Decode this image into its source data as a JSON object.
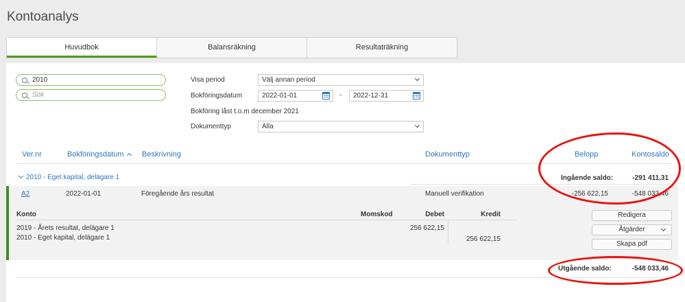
{
  "page": {
    "title": "Kontoanalys"
  },
  "tabs": [
    {
      "label": "Huvudbok",
      "active": true
    },
    {
      "label": "Balansräkning",
      "active": false
    },
    {
      "label": "Resultaträkning",
      "active": false
    }
  ],
  "filters": {
    "account_search_value": "2010",
    "search_placeholder": "Sök",
    "visa_period_label": "Visa period",
    "visa_period_value": "Välj annan period",
    "bokforingsdatum_label": "Bokföringsdatum",
    "date_from": "2022-01-01",
    "date_separator": "-",
    "date_to": "2022-12-31",
    "locked_note": "Bokföring låst t.o.m december 2021",
    "dokumenttyp_label": "Dokumenttyp",
    "dokumenttyp_value": "Alla"
  },
  "table": {
    "headers": {
      "vernr": "Ver.nr",
      "bokforingsdatum": "Bokföringsdatum",
      "beskrivning": "Beskrivning",
      "dokumenttyp": "Dokumenttyp",
      "belopp": "Belopp",
      "kontosaldo": "Kontosaldo"
    },
    "group": {
      "label": "2010 - Eget kapital, delägare 1",
      "opening_label": "Ingående saldo:",
      "opening_value": "-291 411,31"
    },
    "row": {
      "vernr": "A2",
      "date": "2022-01-01",
      "description": "Föregående års resultat",
      "doctype": "Manuell verifikation",
      "belopp": "-256 622,15",
      "kontosaldo": "-548 033,46"
    },
    "details": {
      "headers": {
        "konto": "Konto",
        "momskod": "Momskod",
        "debet": "Debet",
        "kredit": "Kredit"
      },
      "lines": [
        {
          "konto": "2019 - Årets resultat, delägare 1",
          "debet": "256 622,15",
          "kredit": ""
        },
        {
          "konto": "2010 - Eget kapital, delägare 1",
          "debet": "",
          "kredit": "256 622,15"
        }
      ],
      "buttons": {
        "redigera": "Redigera",
        "atgarder": "Åtgärder",
        "skapa_pdf": "Skapa pdf"
      }
    },
    "closing": {
      "label": "Utgående saldo:",
      "value": "-548 033,46"
    }
  },
  "colors": {
    "accent": "#2b77bd",
    "active_tab": "#4a9a1d",
    "annotation": "#e8140f"
  }
}
